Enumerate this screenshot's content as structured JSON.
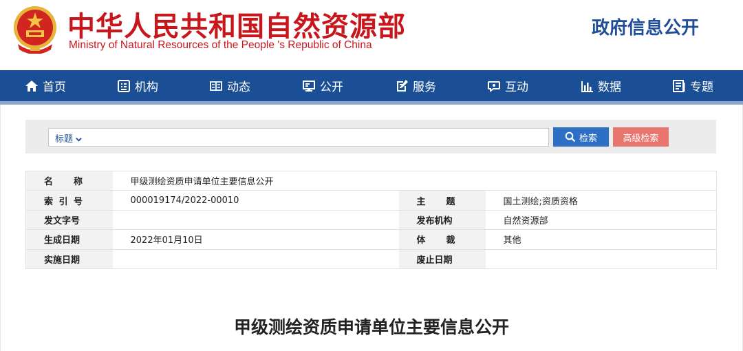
{
  "header": {
    "title_cn": "中华人民共和国自然资源部",
    "title_en": "Ministry of Natural Resources of the People 's Republic of China",
    "gov_info": "政府信息公开"
  },
  "nav": {
    "items": [
      {
        "label": "首页",
        "icon": "home-icon"
      },
      {
        "label": "机构",
        "icon": "org-icon"
      },
      {
        "label": "动态",
        "icon": "news-icon"
      },
      {
        "label": "公开",
        "icon": "monitor-icon"
      },
      {
        "label": "服务",
        "icon": "edit-icon"
      },
      {
        "label": "互动",
        "icon": "chat-icon"
      },
      {
        "label": "数据",
        "icon": "bar-chart-icon"
      },
      {
        "label": "专题",
        "icon": "topic-icon"
      }
    ]
  },
  "search": {
    "field_select": "标题",
    "placeholder": "",
    "search_button": "检索",
    "advanced_button": "高级检索"
  },
  "info": {
    "name_label": [
      "名",
      "称"
    ],
    "name_value": "甲级测绘资质申请单位主要信息公开",
    "index_label": [
      "索",
      "引",
      "号"
    ],
    "index_value": "000019174/2022-00010",
    "subject_label": [
      "主",
      "题"
    ],
    "subject_value": "国土测绘;资质资格",
    "doc_no_label": "发文字号",
    "doc_no_value": "",
    "publisher_label": "发布机构",
    "publisher_value": "自然资源部",
    "date_label": "生成日期",
    "date_value": "2022年01月10日",
    "genre_label": [
      "体",
      "裁"
    ],
    "genre_value": "其他",
    "effective_label": "实施日期",
    "effective_value": "",
    "expiry_label": "废止日期",
    "expiry_value": ""
  },
  "document": {
    "title": "甲级测绘资质申请单位主要信息公开"
  },
  "colors": {
    "brand_red": "#c8161d",
    "nav_blue": "#1b4f95",
    "search_blue": "#2e6fc6",
    "advanced_red": "#e8766f"
  }
}
